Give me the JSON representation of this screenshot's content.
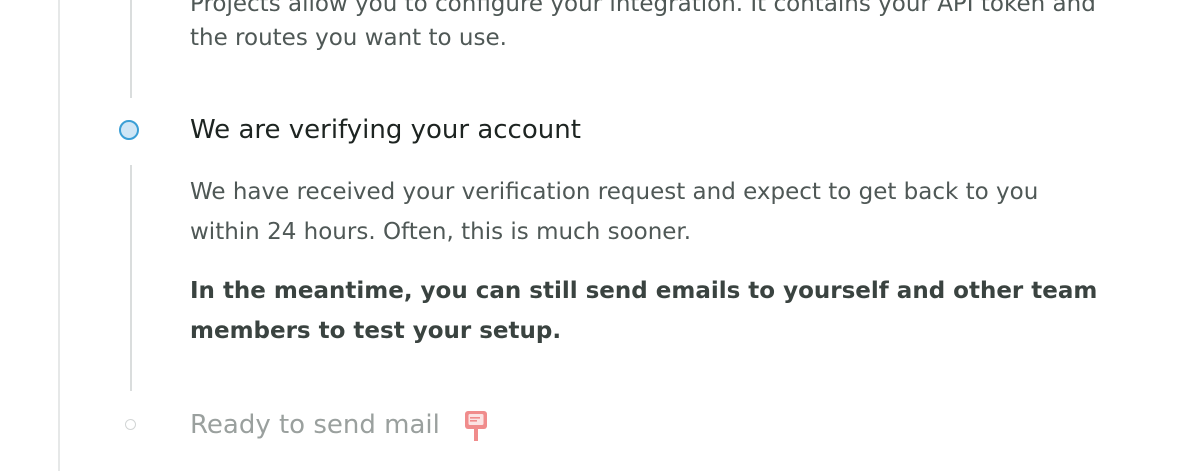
{
  "intro": {
    "line1": "Projects allow you to configure your integration. It contains your API token and",
    "line2": "the routes you want to use."
  },
  "steps": [
    {
      "title": "We are verifying your account",
      "status": "active",
      "paragraph1_line1": "We have received your verification request and expect to get back to you",
      "paragraph1_line2": "within 24 hours. Often, this is much sooner.",
      "paragraph2_line1": "In the meantime, you can still send emails to yourself and other team",
      "paragraph2_line2": "members to test your setup."
    },
    {
      "title": "Ready to send mail",
      "status": "pending",
      "icon": "mailbox-icon"
    }
  ],
  "colors": {
    "active_dot_border": "#3b9fd6",
    "active_dot_fill": "#cfe6f6",
    "mailbox_icon": "#f08c8c"
  }
}
